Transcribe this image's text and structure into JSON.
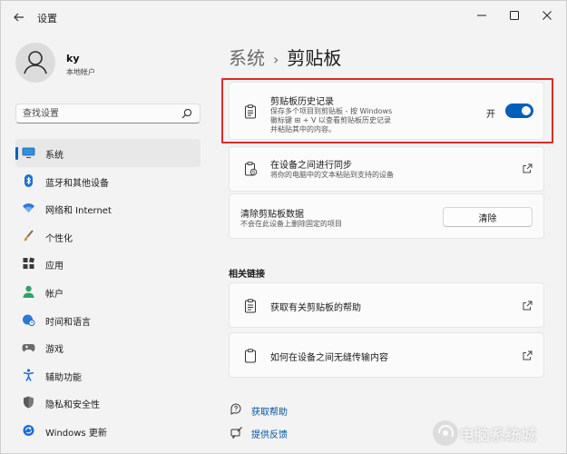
{
  "window": {
    "title": "设置",
    "back_icon": "back-arrow-icon",
    "minimize": "—",
    "maximize": "☐",
    "close": "✕"
  },
  "user": {
    "name": "ky",
    "account_type": "本地帐户"
  },
  "search": {
    "placeholder": "查找设置"
  },
  "sidebar": {
    "items": [
      {
        "label": "系统",
        "icon": "monitor-icon",
        "active": true
      },
      {
        "label": "蓝牙和其他设备",
        "icon": "bluetooth-icon"
      },
      {
        "label": "网络和 Internet",
        "icon": "wifi-icon"
      },
      {
        "label": "个性化",
        "icon": "brush-icon"
      },
      {
        "label": "应用",
        "icon": "apps-icon"
      },
      {
        "label": "帐户",
        "icon": "person-icon"
      },
      {
        "label": "时间和语言",
        "icon": "globe-clock-icon"
      },
      {
        "label": "游戏",
        "icon": "gamepad-icon"
      },
      {
        "label": "辅助功能",
        "icon": "accessibility-icon"
      },
      {
        "label": "隐私和安全性",
        "icon": "shield-icon"
      },
      {
        "label": "Windows 更新",
        "icon": "update-icon"
      }
    ]
  },
  "breadcrumb": {
    "parent": "系统",
    "separator": "›",
    "current": "剪贴板"
  },
  "clipboard_history": {
    "title": "剪贴板历史记录",
    "desc_line1": "保存多个项目到剪贴板 - 按 Windows",
    "desc_line2": "徽标键 ⊞ + V 以查看剪贴板历史记录",
    "desc_line3": "并粘贴其中的内容。",
    "toggle_state": "开",
    "toggle_on": true
  },
  "sync": {
    "title": "在设备之间进行同步",
    "desc": "将你的电脑中的文本粘贴到支持的设备"
  },
  "clear_data": {
    "title": "清除剪贴板数据",
    "desc": "不会在此设备上删除固定的项目",
    "button": "清除"
  },
  "related": {
    "title": "相关链接",
    "items": [
      {
        "label": "获取有关剪贴板的帮助"
      },
      {
        "label": "如何在设备之间无缝传输内容"
      }
    ]
  },
  "links": {
    "help": "获取帮助",
    "feedback": "提供反馈"
  },
  "watermark": {
    "text": "电脑系统城"
  },
  "colors": {
    "accent": "#005fb8",
    "highlight": "#e0292b"
  }
}
